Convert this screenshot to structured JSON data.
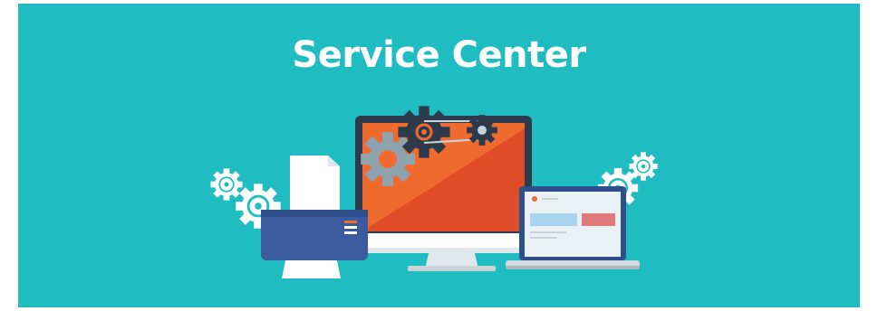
{
  "banner": {
    "title": "Service Center",
    "background_color": "#1fbcc2"
  },
  "illustration": {
    "items": [
      "gear-icon",
      "printer-icon",
      "monitor-icon",
      "laptop-icon"
    ],
    "colors": {
      "screen_orange": "#ef6a2f",
      "screen_red": "#df4c25",
      "printer_blue": "#3b5b9e",
      "dark_navy": "#2d3a4b",
      "gear_gray": "#8ea3ad",
      "laptop_blue": "#2f4f8a"
    }
  }
}
